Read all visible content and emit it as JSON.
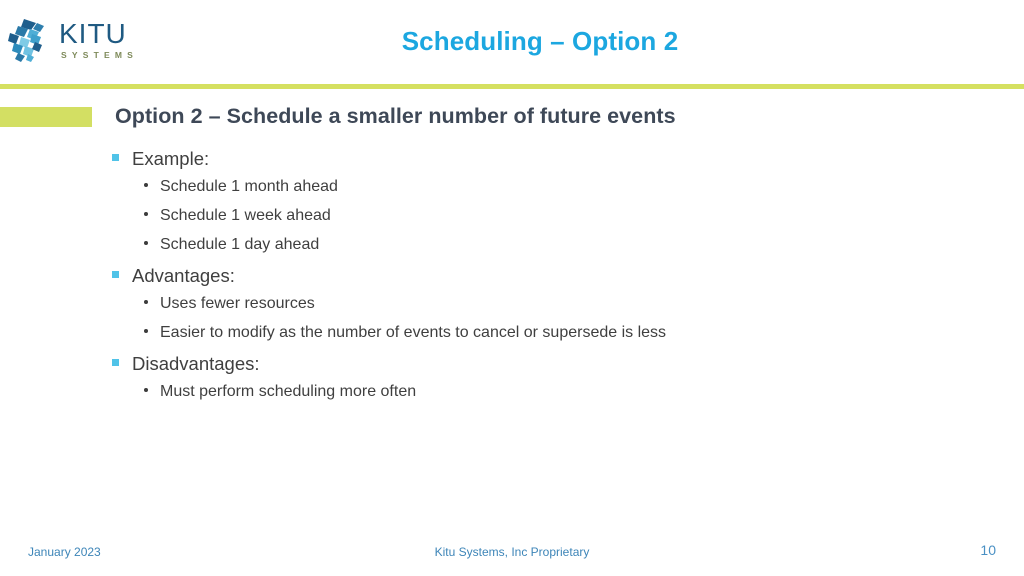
{
  "slide": {
    "title": "Scheduling – Option 2",
    "section_subtitle": "Option 2 – Schedule a smaller number of future events"
  },
  "logo": {
    "mark_name": "kitu-network-mark",
    "wordmark_primary": "KITU",
    "wordmark_secondary": "SYSTEMS"
  },
  "content": {
    "groups": [
      {
        "heading": "Example:",
        "items": [
          "Schedule 1 month ahead",
          "Schedule 1 week ahead",
          "Schedule 1 day ahead"
        ]
      },
      {
        "heading": "Advantages:",
        "items": [
          "Uses fewer resources",
          "Easier to modify as the number of events to cancel or supersede is less"
        ]
      },
      {
        "heading": "Disadvantages:",
        "items": [
          "Must perform scheduling more often"
        ]
      }
    ]
  },
  "footer": {
    "date": "January 2023",
    "note": "Kitu Systems, Inc Proprietary",
    "page_number": "10"
  },
  "colors": {
    "title_blue": "#1CA7E0",
    "accent_green": "#D3DF63",
    "rule_green": "#D5E061",
    "subtitle_slate": "#3E4857",
    "bullet_square_blue": "#50C3E8",
    "body_gray": "#3F3F3F",
    "footer_blue": "#3D85B8",
    "logo_navy": "#1F5A82",
    "logo_olive": "#7E8A5A"
  }
}
